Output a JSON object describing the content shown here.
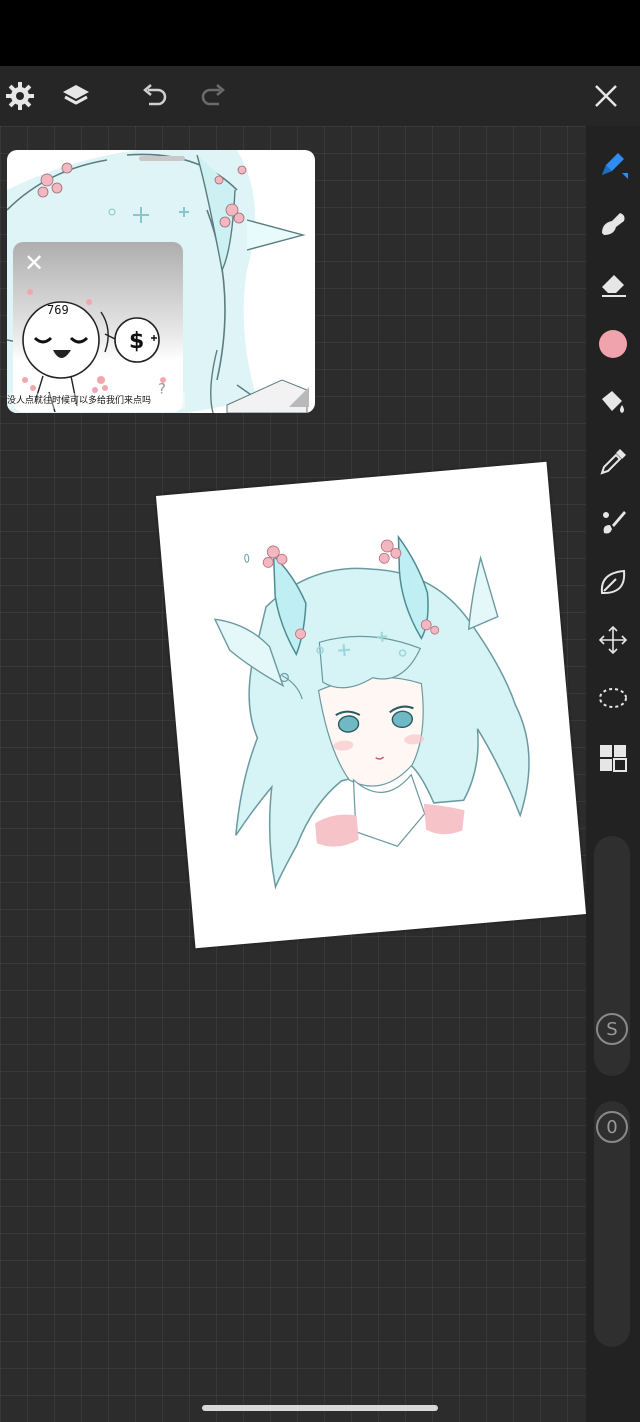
{
  "toolbar": {
    "settings": "settings-icon",
    "layers": "layers-icon",
    "undo": "undo-icon",
    "redo": "redo-icon",
    "close": "close-icon"
  },
  "tools": [
    {
      "name": "pen",
      "icon": "pen-icon",
      "active": true
    },
    {
      "name": "smudge",
      "icon": "smudge-icon"
    },
    {
      "name": "eraser",
      "icon": "eraser-icon"
    },
    {
      "name": "color",
      "icon": "color-swatch",
      "color": "#f0a3ad"
    },
    {
      "name": "fill",
      "icon": "paint-bucket-icon"
    },
    {
      "name": "eyedropper",
      "icon": "eyedropper-icon"
    },
    {
      "name": "brush",
      "icon": "brush-icon"
    },
    {
      "name": "lasso-fill",
      "icon": "leaf-icon"
    },
    {
      "name": "transform",
      "icon": "move-arrows-icon"
    },
    {
      "name": "selection",
      "icon": "lasso-selection-icon"
    },
    {
      "name": "panels",
      "icon": "grid-icon"
    }
  ],
  "sliders": {
    "size_label": "S",
    "opacity_label": "0"
  },
  "reference": {
    "ad_close": "✕",
    "ad_caption": "没人点就往时候可以多给我们来点吗",
    "ad_help": "?",
    "doodle_number": "769",
    "doodle_money": "$"
  },
  "colors": {
    "accent": "#2f8cf0",
    "active_color": "#f0a3ad"
  }
}
